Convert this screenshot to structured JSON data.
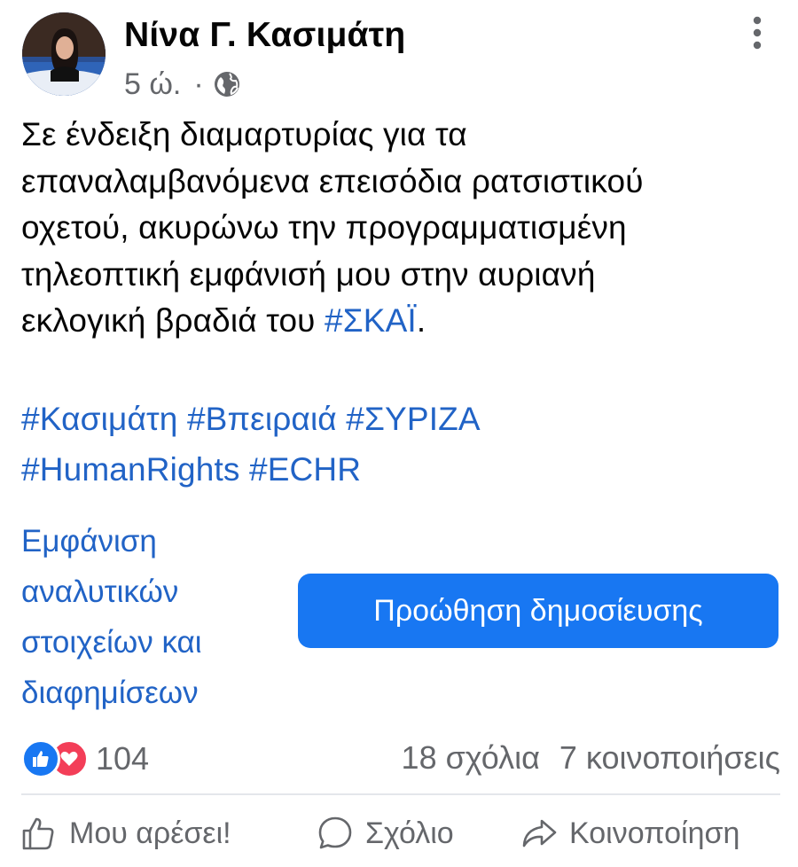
{
  "post": {
    "author": "Νίνα Γ. Κασιμάτη",
    "time": "5 ώ.",
    "separator": "·",
    "privacy_icon": "globe-icon",
    "menu_icon": "more-vertical-icon",
    "text_lines": [
      "Σε ένδειξη διαμαρτυρίας για τα",
      "επαναλαμβανόμενα επεισόδια ρατσιστικού",
      "οχετού, ακυρώνω την προγραμματισμένη",
      "τηλεοπτική εμφάνισή μου στην αυριανή"
    ],
    "text_last_line_prefix": "εκλογική βραδιά του ",
    "text_link": "#ΣΚΑΪ",
    "text_last_line_suffix": ".",
    "hashtags": {
      "h1": "#Κασιμάτη",
      "h2": "#Βπειραιά",
      "h3": "#ΣΥΡΙΖΑ",
      "h4": "#HumanRights",
      "h5": "#ECHR"
    },
    "insights_lines": [
      "Εμφάνιση",
      "αναλυτικών",
      "στοιχείων και",
      "διαφημίσεων"
    ],
    "boost_label": "Προώθηση δημοσίευσης"
  },
  "stats": {
    "reactions_count": "104",
    "comments": "18 σχόλια",
    "shares": "7 κοινοποιήσεις"
  },
  "actions": {
    "like": "Μου αρέσει!",
    "comment": "Σχόλιο",
    "share": "Κοινοποίηση"
  },
  "colors": {
    "link": "#2163c6",
    "accent": "#1877f2",
    "love": "#f33e58",
    "secondary_text": "#65676b"
  }
}
